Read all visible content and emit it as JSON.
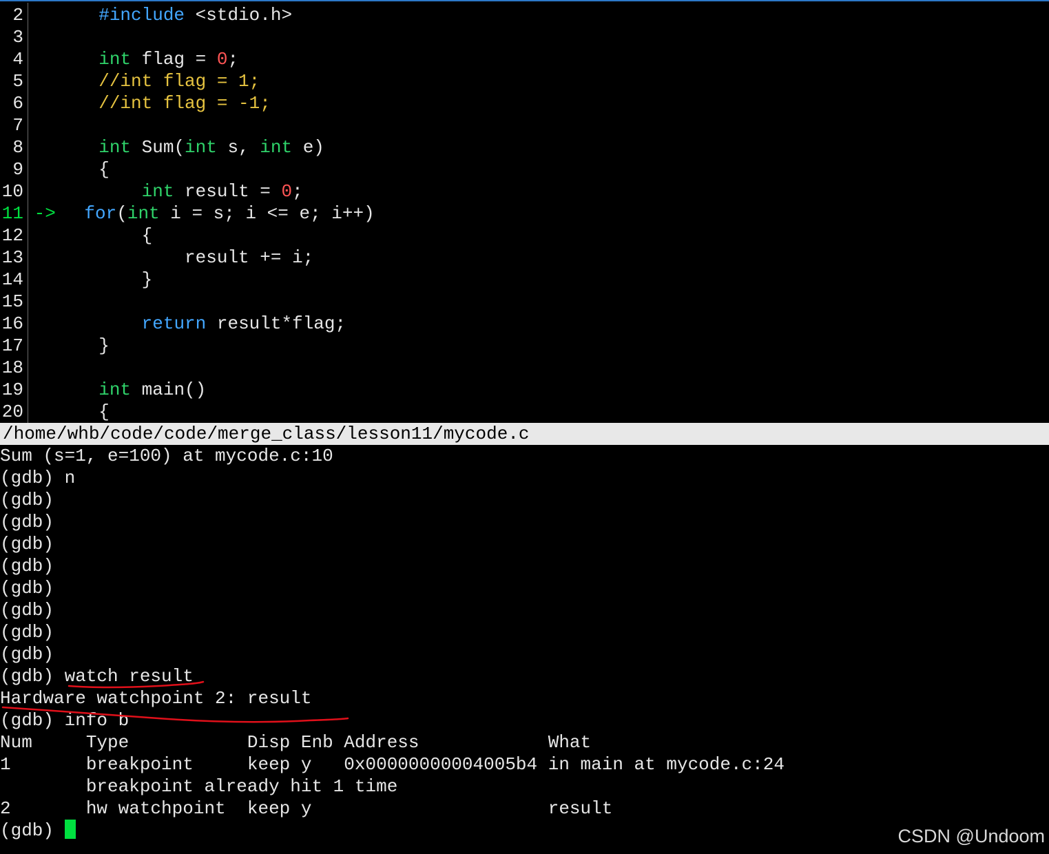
{
  "source_pane": {
    "lines": [
      {
        "num": "2",
        "t1": "#include",
        "t2": " <stdio.h>"
      },
      {
        "num": "3"
      },
      {
        "num": "4",
        "t1": "int",
        "t2": " flag = ",
        "t3": "0",
        "t4": ";"
      },
      {
        "num": "5",
        "t1": "//int flag = 1;"
      },
      {
        "num": "6",
        "t1": "//int flag = -1;"
      },
      {
        "num": "7"
      },
      {
        "num": "8",
        "t1": "int",
        "t2": " Sum(",
        "t3": "int",
        "t4": " s, ",
        "t5": "int",
        "t6": " e)"
      },
      {
        "num": "9",
        "t1": "{"
      },
      {
        "num": "10",
        "t1": "    ",
        "t2": "int",
        "t3": " result = ",
        "t4": "0",
        "t5": ";"
      },
      {
        "num": "11",
        "arrow": "->",
        "t1": "   ",
        "t2": "for",
        "t3": "(",
        "t4": "int",
        "t5": " i = s; i <= e; i++)"
      },
      {
        "num": "12",
        "t1": "    {"
      },
      {
        "num": "13",
        "t1": "        result += i;"
      },
      {
        "num": "14",
        "t1": "    }"
      },
      {
        "num": "15"
      },
      {
        "num": "16",
        "t1": "    ",
        "t2": "return",
        "t3": " result*flag;"
      },
      {
        "num": "17",
        "t1": "}"
      },
      {
        "num": "18"
      },
      {
        "num": "19",
        "t1": "int",
        "t2": " main()"
      },
      {
        "num": "20",
        "t1": "{"
      }
    ]
  },
  "status_bar": {
    "path": "/home/whb/code/code/merge_class/lesson11/mycode.c"
  },
  "console": {
    "lines": [
      "Sum (s=1, e=100) at mycode.c:10",
      "(gdb) n",
      "(gdb)",
      "(gdb)",
      "(gdb)",
      "(gdb)",
      "(gdb)",
      "(gdb)",
      "(gdb)",
      "(gdb)",
      "(gdb) watch result",
      "Hardware watchpoint 2: result",
      "(gdb) info b",
      "Num     Type           Disp Enb Address            What",
      "1       breakpoint     keep y   0x00000000004005b4 in main at mycode.c:24",
      "        breakpoint already hit 1 time",
      "2       hw watchpoint  keep y                      result"
    ],
    "prompt": "(gdb) "
  },
  "watermark": "CSDN @Undoom",
  "colors": {
    "keyword": "#2fd36a",
    "preprocessor": "#43a7ff",
    "number": "#ff5555",
    "comment": "#e6c340",
    "cursor": "#00e040",
    "annotation": "#e0101a"
  }
}
